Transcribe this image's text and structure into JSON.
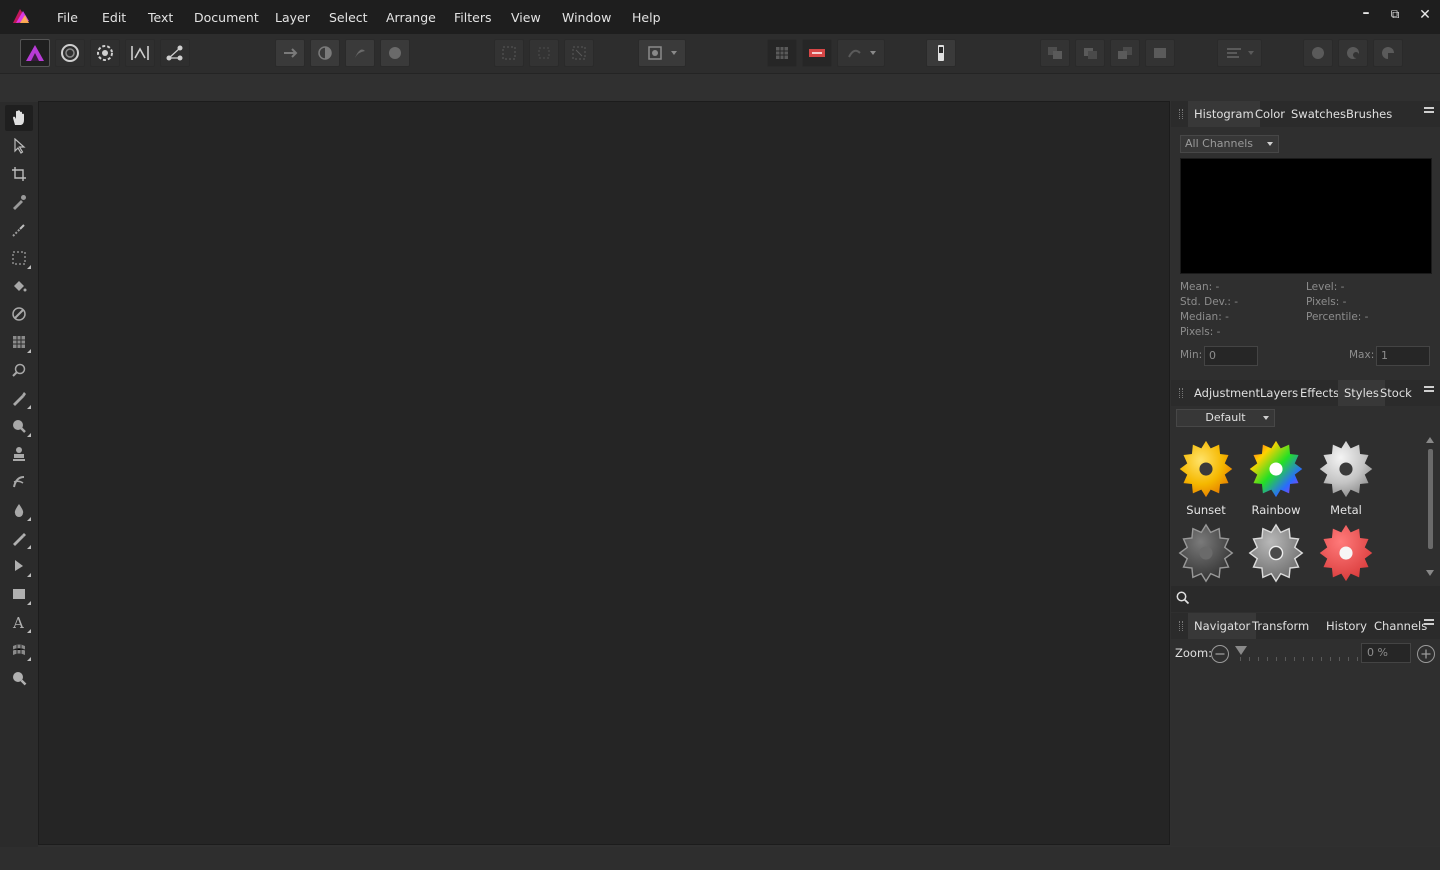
{
  "menubar": {
    "items": [
      "File",
      "Edit",
      "Text",
      "Document",
      "Layer",
      "Select",
      "Arrange",
      "Filters",
      "View",
      "Window",
      "Help"
    ],
    "window_controls": {
      "minimize": "–",
      "maximize": "⧉",
      "close": "✕"
    }
  },
  "colors": {
    "app_accent": "#e040fb",
    "background": "#303030",
    "canvas": "#252525",
    "menubar": "#1e1e1e"
  },
  "toolbar": {
    "personas": [
      "photo-persona-icon",
      "liquify-persona-icon",
      "develop-persona-icon",
      "tone-mapping-persona-icon",
      "export-persona-icon"
    ]
  },
  "tools": [
    "hand-tool-icon",
    "move-tool-icon",
    "crop-tool-icon",
    "color-picker-icon",
    "selection-brush-icon",
    "marquee-icon",
    "flood-fill-icon",
    "paint-brush-icon",
    "pixel-grid-icon",
    "dodge-icon",
    "clone-icon",
    "blur-icon",
    "stamp-icon",
    "smudge-icon",
    "drop-icon",
    "pen-icon",
    "node-tool-icon",
    "rectangle-icon",
    "text-tool-icon",
    "mesh-tool-icon",
    "zoom-tool-icon"
  ],
  "histogram_panel": {
    "tabs": [
      "Histogram",
      "Color",
      "Swatches",
      "Brushes"
    ],
    "channel_select": "All Channels",
    "stats_left": [
      "Mean: -",
      "Std. Dev.: -",
      "Median: -",
      "Pixels: -"
    ],
    "stats_right": [
      "Level: -",
      "Pixels: -",
      "Percentile: -"
    ],
    "min_label": "Min:",
    "min_value": "0",
    "max_label": "Max:",
    "max_value": "1"
  },
  "styles_panel": {
    "tabs": [
      "Adjustment",
      "Layers",
      "Effects",
      "Styles",
      "Stock"
    ],
    "category": "Default",
    "styles": [
      {
        "name": "Sunset"
      },
      {
        "name": "Rainbow"
      },
      {
        "name": "Metal"
      },
      {
        "name": ""
      },
      {
        "name": ""
      },
      {
        "name": ""
      }
    ]
  },
  "navigator_panel": {
    "tabs": [
      "Navigator",
      "Transform",
      "History",
      "Channels"
    ],
    "zoom_label": "Zoom:",
    "zoom_value": "0 %"
  }
}
